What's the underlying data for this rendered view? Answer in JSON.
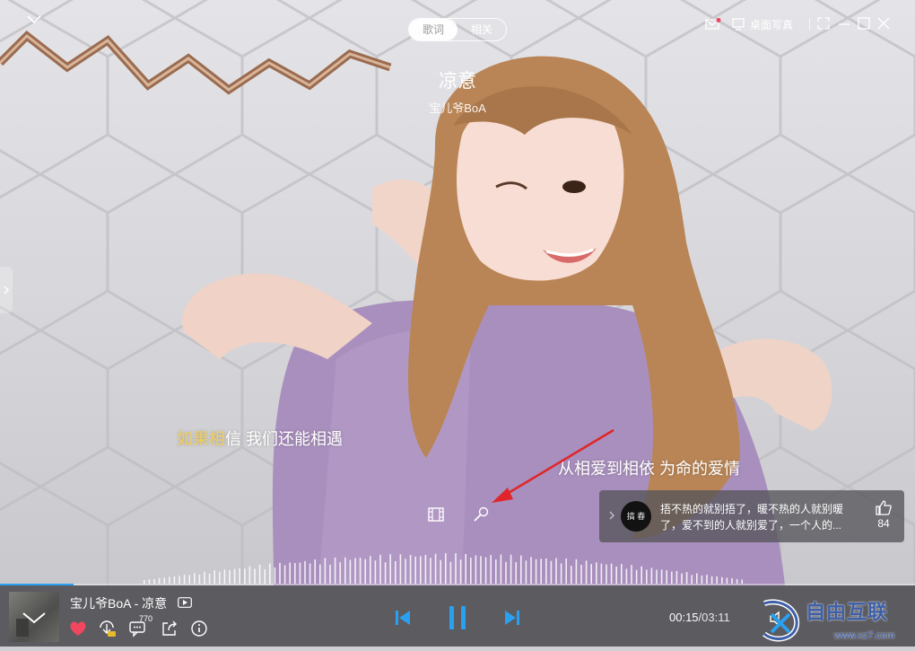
{
  "top_bar": {
    "tabs": [
      {
        "label": "歌词",
        "active": true
      },
      {
        "label": "相关",
        "active": false
      }
    ],
    "desktop_photo_label": "桌面写真"
  },
  "song": {
    "title": "凉意",
    "artist": "宝儿爷BoA"
  },
  "lyrics": {
    "line1_sung": "如果相",
    "line1_rest": "信 我们还能相遇",
    "line2": "从相爱到相依 为命的爱情"
  },
  "comment": {
    "avatar_text": "搞 春",
    "text": "捂不热的就别捂了，暖不热的人就别暖了，爱不到的人就别爱了，一个人的...",
    "likes": "84"
  },
  "player": {
    "now_playing": "宝儿爷BoA - 凉意",
    "comment_count": "770",
    "current_time": "00:15",
    "duration": "/03:11",
    "progress_fraction": 0.08
  },
  "watermark": {
    "text": "自由互联",
    "url": "www.xz7.com"
  },
  "colors": {
    "accent": "#2aa0f0",
    "lyric_highlight": "#f2cf5b",
    "heart": "#f0475e"
  }
}
